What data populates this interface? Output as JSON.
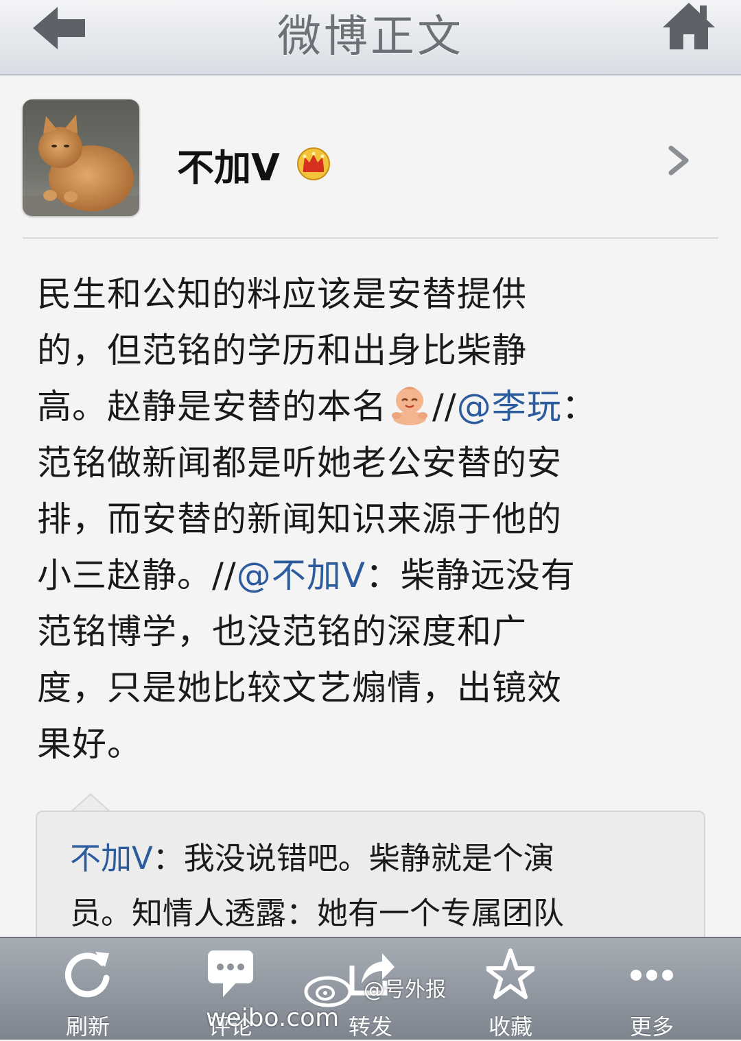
{
  "header": {
    "title": "微博正文"
  },
  "user": {
    "name": "不加V"
  },
  "post": {
    "line1": "民生和公知的料应该是安替提供",
    "line2": "的，但范铭的学历和出身比柴静",
    "line3a": "高。赵静是安替的本名",
    "line3b": "//",
    "mention1": "@李玩",
    "line3c": "：",
    "line4": "范铭做新闻都是听她老公安替的安",
    "line5": "排，而安替的新闻知识来源于他的",
    "line6a": "小三赵静。//",
    "mention2": "@不加V",
    "line6b": "：柴静远没有",
    "line7": "范铭博学，也没范铭的深度和广",
    "line8": "度，只是她比较文艺煽情，出镜效",
    "line9": "果好。"
  },
  "repost": {
    "author": "不加V",
    "text1": "：我没说错吧。柴静就是个演",
    "text2": "员。知情人透露：她有一个专属团队"
  },
  "toolbar": {
    "items": [
      {
        "label": "刷新",
        "icon": "refresh-icon"
      },
      {
        "label": "评论",
        "icon": "comment-icon"
      },
      {
        "label": "转发",
        "icon": "share-icon"
      },
      {
        "label": "收藏",
        "icon": "star-icon"
      },
      {
        "label": "更多",
        "icon": "more-icon"
      }
    ]
  },
  "watermark": {
    "handle": "@号外报",
    "domain": "weibo.com"
  },
  "colors": {
    "mention": "#2c5c9e",
    "header_title": "#6d7076",
    "toolbar_bg": "#8d939b"
  }
}
